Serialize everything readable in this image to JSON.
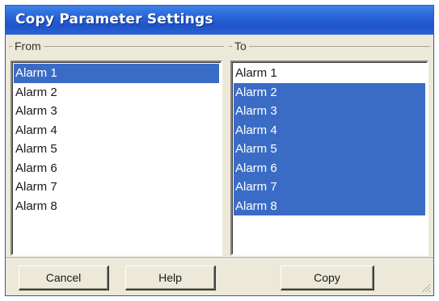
{
  "window": {
    "title": "Copy Parameter Settings"
  },
  "from": {
    "label": "From",
    "items": [
      {
        "label": "Alarm 1",
        "selected": true
      },
      {
        "label": "Alarm 2",
        "selected": false
      },
      {
        "label": "Alarm 3",
        "selected": false
      },
      {
        "label": "Alarm 4",
        "selected": false
      },
      {
        "label": "Alarm 5",
        "selected": false
      },
      {
        "label": "Alarm 6",
        "selected": false
      },
      {
        "label": "Alarm 7",
        "selected": false
      },
      {
        "label": "Alarm 8",
        "selected": false
      }
    ]
  },
  "to": {
    "label": "To",
    "items": [
      {
        "label": "Alarm 1",
        "selected": false
      },
      {
        "label": "Alarm 2",
        "selected": true
      },
      {
        "label": "Alarm 3",
        "selected": true
      },
      {
        "label": "Alarm 4",
        "selected": true
      },
      {
        "label": "Alarm 5",
        "selected": true
      },
      {
        "label": "Alarm 6",
        "selected": true
      },
      {
        "label": "Alarm 7",
        "selected": true
      },
      {
        "label": "Alarm 8",
        "selected": true
      }
    ]
  },
  "buttons": {
    "cancel_label": "Cancel",
    "help_label": "Help",
    "copy_label": "Copy"
  },
  "colors": {
    "title_bar": "#2a66d9",
    "selection": "#3a6cc6",
    "dialog_background": "#ece9d8"
  },
  "icons": {
    "resize_grip": "resize-grip-icon"
  }
}
